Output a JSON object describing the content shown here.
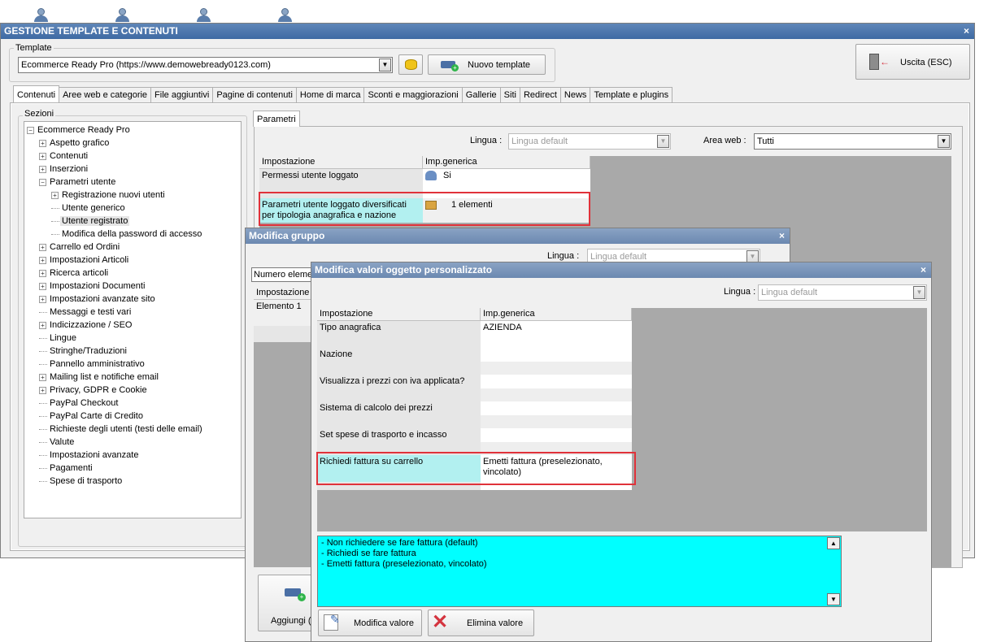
{
  "main_window": {
    "title": "GESTIONE TEMPLATE E CONTENUTI",
    "close_glyph": "×",
    "template_group_label": "Template",
    "template_value": "Ecommerce Ready Pro (https://www.demowebready0123.com)",
    "new_template_label": "Nuovo template",
    "exit_label": "Uscita (ESC)",
    "tabs": [
      "Contenuti",
      "Aree web e categorie",
      "File aggiuntivi",
      "Pagine di contenuti",
      "Home di marca",
      "Sconti e maggiorazioni",
      "Gallerie",
      "Siti",
      "Redirect",
      "News",
      "Template e plugins"
    ],
    "active_tab": "Contenuti"
  },
  "sections": {
    "label": "Sezioni",
    "tree": [
      {
        "label": "Ecommerce Ready Pro",
        "level": 0,
        "expander": "−"
      },
      {
        "label": "Aspetto grafico",
        "level": 1,
        "expander": "+"
      },
      {
        "label": "Contenuti",
        "level": 1,
        "expander": "+"
      },
      {
        "label": "Inserzioni",
        "level": 1,
        "expander": "+"
      },
      {
        "label": "Parametri utente",
        "level": 1,
        "expander": "−"
      },
      {
        "label": "Registrazione nuovi utenti",
        "level": 2,
        "expander": "+"
      },
      {
        "label": "Utente generico",
        "level": 2,
        "expander": ""
      },
      {
        "label": "Utente registrato",
        "level": 2,
        "expander": "",
        "selected": true
      },
      {
        "label": "Modifica della password di accesso",
        "level": 2,
        "expander": ""
      },
      {
        "label": "Carrello ed Ordini",
        "level": 1,
        "expander": "+"
      },
      {
        "label": "Impostazioni Articoli",
        "level": 1,
        "expander": "+"
      },
      {
        "label": "Ricerca articoli",
        "level": 1,
        "expander": "+"
      },
      {
        "label": "Impostazioni Documenti",
        "level": 1,
        "expander": "+"
      },
      {
        "label": "Impostazioni avanzate sito",
        "level": 1,
        "expander": "+"
      },
      {
        "label": "Messaggi e testi vari",
        "level": 1,
        "expander": ""
      },
      {
        "label": "Indicizzazione / SEO",
        "level": 1,
        "expander": "+"
      },
      {
        "label": "Lingue",
        "level": 1,
        "expander": ""
      },
      {
        "label": "Stringhe/Traduzioni",
        "level": 1,
        "expander": ""
      },
      {
        "label": "Pannello amministrativo",
        "level": 1,
        "expander": ""
      },
      {
        "label": "Mailing list e notifiche email",
        "level": 1,
        "expander": "+"
      },
      {
        "label": "Privacy, GDPR e Cookie",
        "level": 1,
        "expander": "+"
      },
      {
        "label": "PayPal Checkout",
        "level": 1,
        "expander": ""
      },
      {
        "label": "PayPal Carte di Credito",
        "level": 1,
        "expander": ""
      },
      {
        "label": "Richieste degli utenti (testi delle email)",
        "level": 1,
        "expander": ""
      },
      {
        "label": "Valute",
        "level": 1,
        "expander": ""
      },
      {
        "label": "Impostazioni avanzate",
        "level": 1,
        "expander": ""
      },
      {
        "label": "Pagamenti",
        "level": 1,
        "expander": ""
      },
      {
        "label": "Spese di trasporto",
        "level": 1,
        "expander": ""
      }
    ]
  },
  "params_panel": {
    "tab_label": "Parametri",
    "lingua_label": "Lingua :",
    "lingua_value": "Lingua default",
    "area_label": "Area web :",
    "area_value": "Tutti",
    "col_setting": "Impostazione",
    "col_value": "Imp.generica",
    "rows": [
      {
        "setting": "Permessi utente loggato",
        "value": "Si"
      },
      {
        "setting": "Parametri utente loggato diversificati per tipologia anagrafica e nazione",
        "value": "1 elementi"
      }
    ]
  },
  "group_dialog": {
    "title": "Modifica gruppo",
    "close_glyph": "×",
    "lingua_label": "Lingua :",
    "lingua_value": "Lingua default",
    "count_label": "Numero elemen",
    "col_setting": "Impostazione",
    "row_label": "Elemento 1",
    "add_label": "Aggiungi (f"
  },
  "object_dialog": {
    "title": "Modifica valori oggetto personalizzato",
    "close_glyph": "×",
    "lingua_label": "Lingua :",
    "lingua_value": "Lingua default",
    "col_setting": "Impostazione",
    "col_value": "Imp.generica",
    "rows": [
      {
        "setting": "Tipo anagrafica",
        "value": "AZIENDA"
      },
      {
        "setting": "Nazione",
        "value": ""
      },
      {
        "setting": "Visualizza i prezzi con iva applicata?",
        "value": ""
      },
      {
        "setting": "Sistema di calcolo dei prezzi",
        "value": ""
      },
      {
        "setting": "Set spese di trasporto e incasso",
        "value": ""
      },
      {
        "setting": "Richiedi fattura su carrello",
        "value": "Emetti fattura (preselezionato, vincolato)"
      }
    ],
    "options": [
      "- Non richiedere se fare fattura (default)",
      "- Richiedi se fare fattura",
      "- Emetti fattura (preselezionato, vincolato)"
    ],
    "edit_label": "Modifica valore",
    "delete_label": "Elimina valore"
  },
  "colors": {
    "highlight": "#e0323a",
    "selected_row": "#b2f0f0",
    "options_bg": "#00ffff"
  }
}
